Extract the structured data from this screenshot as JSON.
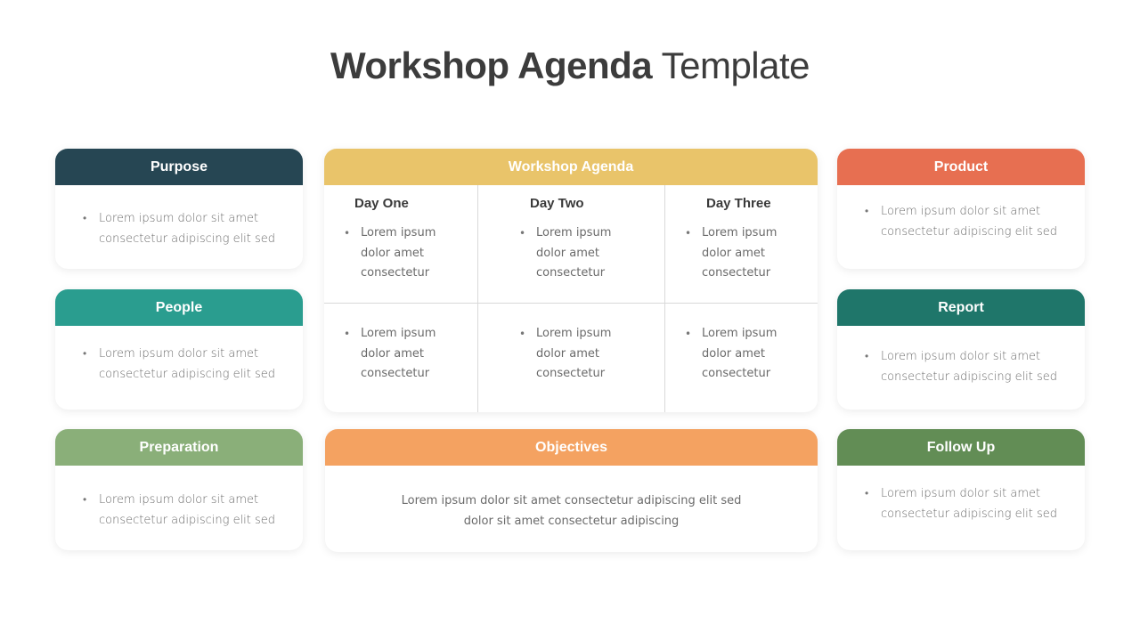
{
  "title": {
    "bold": "Workshop Agenda",
    "light": "Template"
  },
  "colors": {
    "purpose": "#264653",
    "people": "#2a9d8f",
    "preparation": "#8aaf79",
    "agenda": "#e9c46a",
    "objectives": "#f4a261",
    "product": "#e76f51",
    "report": "#1f766a",
    "followup": "#628d55"
  },
  "cards": {
    "purpose": {
      "title": "Purpose",
      "bullet": [
        "Lorem ipsum dolor sit amet",
        "consectetur adipiscing elit sed"
      ]
    },
    "people": {
      "title": "People",
      "bullet": [
        "Lorem ipsum dolor sit amet",
        "consectetur adipiscing elit sed"
      ]
    },
    "preparation": {
      "title": "Preparation",
      "bullet": [
        "Lorem ipsum dolor sit amet",
        "consectetur adipiscing elit sed"
      ]
    },
    "product": {
      "title": "Product",
      "bullet": [
        "Lorem ipsum dolor sit amet",
        "consectetur adipiscing elit sed"
      ]
    },
    "report": {
      "title": "Report",
      "bullet": [
        "Lorem ipsum dolor sit amet",
        "consectetur adipiscing elit sed"
      ]
    },
    "followup": {
      "title": "Follow Up",
      "bullet": [
        "Lorem ipsum dolor sit amet",
        "consectetur adipiscing elit sed"
      ]
    }
  },
  "agenda": {
    "title": "Workshop Agenda",
    "days": [
      {
        "title": "Day One",
        "top": [
          "Lorem ipsum",
          "dolor amet",
          "consectetur"
        ],
        "bottom": [
          "Lorem ipsum",
          "dolor amet",
          "consectetur"
        ]
      },
      {
        "title": "Day Two",
        "top": [
          "Lorem ipsum",
          "dolor amet",
          "consectetur"
        ],
        "bottom": [
          "Lorem ipsum",
          "dolor amet",
          "consectetur"
        ]
      },
      {
        "title": "Day Three",
        "top": [
          "Lorem ipsum",
          "dolor amet",
          "consectetur"
        ],
        "bottom": [
          "Lorem ipsum",
          "dolor amet",
          "consectetur"
        ]
      }
    ]
  },
  "objectives": {
    "title": "Objectives",
    "text": [
      "Lorem ipsum dolor sit amet consectetur adipiscing elit sed",
      "dolor sit amet consectetur adipiscing"
    ]
  }
}
